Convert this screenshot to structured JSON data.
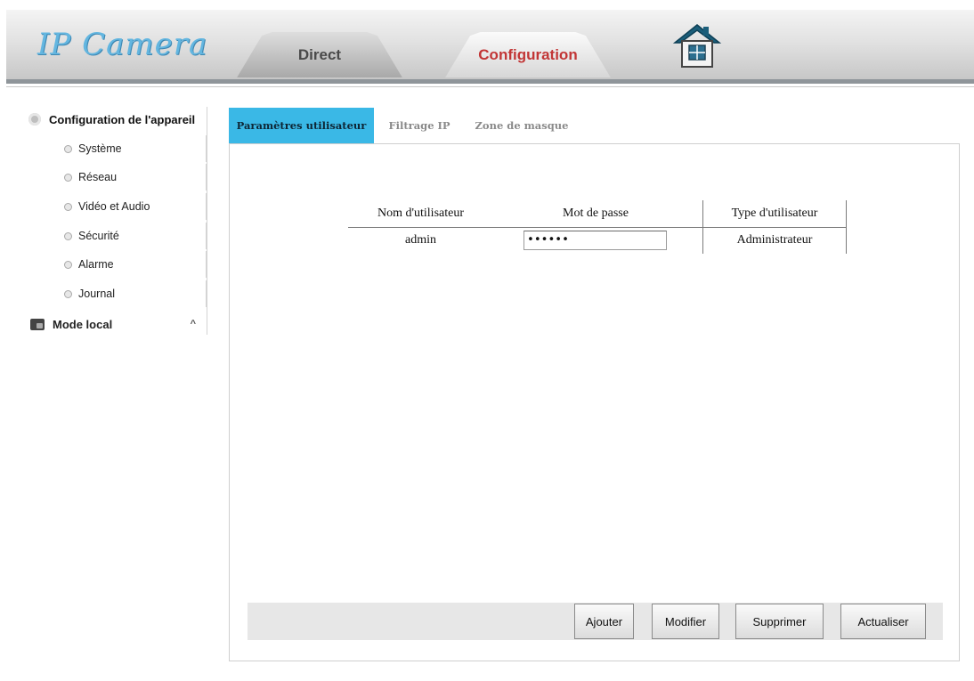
{
  "header": {
    "logo": "IP Camera",
    "tabs": [
      {
        "label": "Direct"
      },
      {
        "label": "Configuration",
        "active": true
      }
    ],
    "home_icon": "home-icon"
  },
  "sidebar": {
    "section_title": "Configuration de l'appareil",
    "section_icon": "gear-icon",
    "items": [
      {
        "label": "Système"
      },
      {
        "label": "Réseau"
      },
      {
        "label": "Vidéo et Audio"
      },
      {
        "label": "Sécurité"
      },
      {
        "label": "Alarme"
      },
      {
        "label": "Journal"
      }
    ],
    "mode_local": "Mode local",
    "mode_local_icon": "monitor-icon",
    "mode_local_caret": "^"
  },
  "content_tabs": [
    {
      "label": "Paramètres utilisateur",
      "active": true
    },
    {
      "label": "Filtrage IP"
    },
    {
      "label": "Zone de masque"
    }
  ],
  "user_table": {
    "headers": [
      "Nom d'utilisateur",
      "Mot de passe",
      "Type d'utilisateur"
    ],
    "rows": [
      {
        "username": "admin",
        "password": "••••••",
        "type": "Administrateur"
      }
    ]
  },
  "buttons": {
    "add": "Ajouter",
    "modify": "Modifier",
    "delete": "Supprimer",
    "refresh": "Actualiser"
  },
  "colors": {
    "active_tab": "#3ab8e6",
    "config_tab_text": "#c23636",
    "logo": "#63b6e0"
  }
}
